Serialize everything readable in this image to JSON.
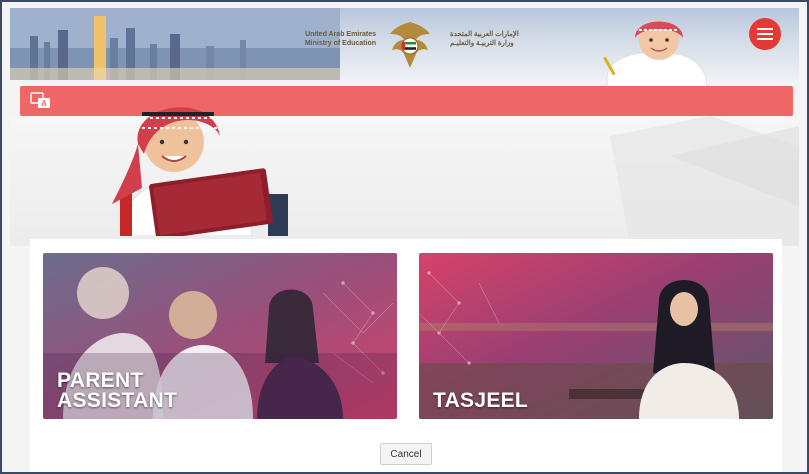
{
  "header": {
    "title_en": "United Arab Emirates\nMinistry of Education",
    "title_ar": "الإمارات العربية المتحدة\nوزارة التربيـة والتعليـم"
  },
  "cards": [
    {
      "label": "PARENT\nASSISTANT"
    },
    {
      "label": "TASJEEL"
    }
  ],
  "actions": {
    "cancel_label": "Cancel"
  },
  "colors": {
    "accent_red": "#e53935",
    "bar_red": "#ef6666",
    "card_overlay": "#8a2a6e"
  },
  "icons": {
    "menu": "hamburger-icon",
    "language": "language-toggle-icon",
    "emblem": "uae-emblem-icon"
  }
}
